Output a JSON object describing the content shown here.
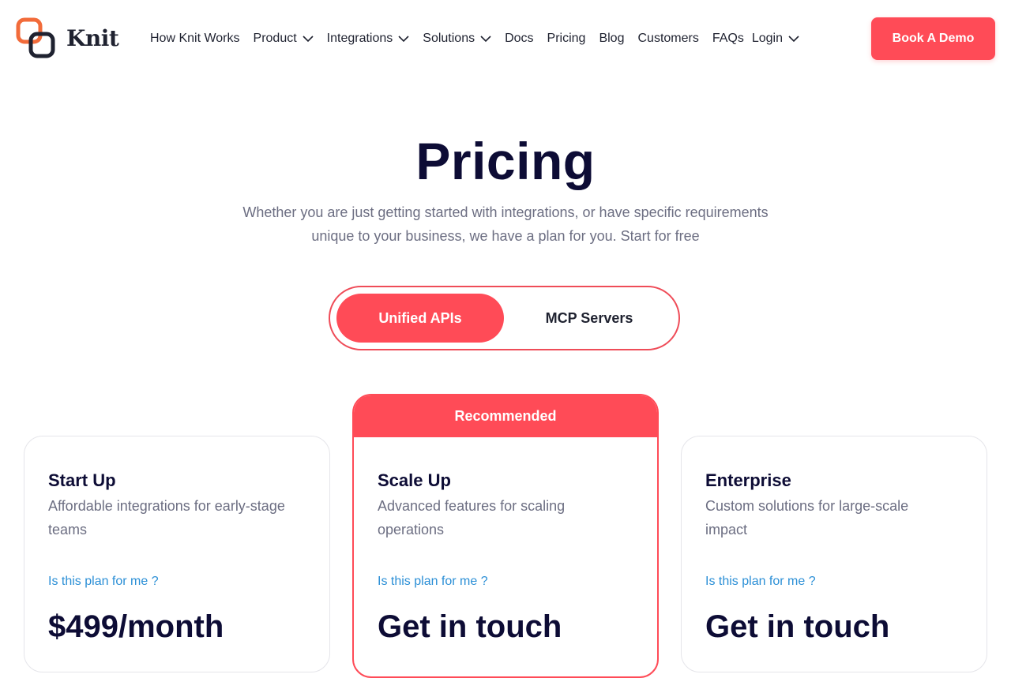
{
  "brand": {
    "name": "Knit",
    "accent": "#ff4b57",
    "dark": "#1f2230"
  },
  "nav": {
    "items": [
      {
        "label": "How Knit Works",
        "dropdown": false
      },
      {
        "label": "Product",
        "dropdown": true
      },
      {
        "label": "Integrations",
        "dropdown": true
      },
      {
        "label": "Solutions",
        "dropdown": true
      },
      {
        "label": "Docs",
        "dropdown": false
      },
      {
        "label": "Pricing",
        "dropdown": false
      },
      {
        "label": "Blog",
        "dropdown": false
      },
      {
        "label": "Customers",
        "dropdown": false
      },
      {
        "label": "FAQs",
        "dropdown": false
      },
      {
        "label": "Login",
        "dropdown": true
      }
    ],
    "cta": "Book A Demo"
  },
  "hero": {
    "title": "Pricing",
    "subtitle_line1": "Whether you are just getting started with integrations, or have specific requirements",
    "subtitle_line2": "unique to your business, we have a plan for you. Start for free"
  },
  "toggle": {
    "options": [
      "Unified APIs",
      "MCP Servers"
    ],
    "selected": "Unified APIs"
  },
  "plans": [
    {
      "name": "Start Up",
      "description": "Affordable integrations for early-stage teams",
      "link": "Is this plan for me ?",
      "price": "$499/month"
    },
    {
      "badge": "Recommended",
      "name": "Scale Up",
      "description": "Advanced features for scaling operations",
      "link": "Is this plan for me ?",
      "price": "Get in touch"
    },
    {
      "name": "Enterprise",
      "description": "Custom solutions for large-scale impact",
      "link": "Is this plan for me ?",
      "price": "Get in touch"
    }
  ]
}
